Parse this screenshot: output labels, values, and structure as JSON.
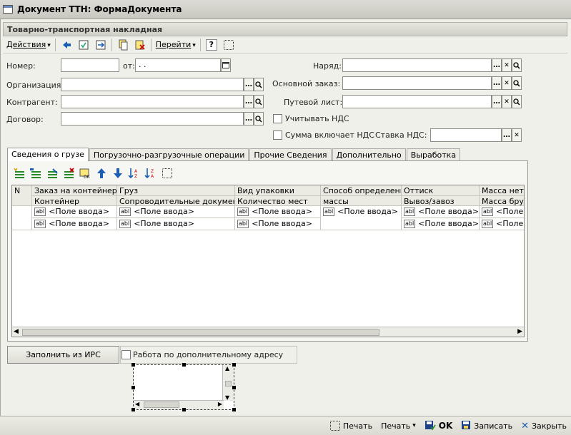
{
  "window": {
    "title": "Документ ТТН: ФормаДокумента"
  },
  "form": {
    "header": "Товарно-транспортная накладная"
  },
  "toolbar": {
    "actions_label": "Действия",
    "goto_label": "Перейти",
    "help_label": "?"
  },
  "fields": {
    "number_label": "Номер:",
    "from_label": "от:",
    "date_value": " .  .",
    "organization_label": "Организация:",
    "counterparty_label": "Контрагент:",
    "contract_label": "Договор:",
    "work_order_label": "Наряд:",
    "main_order_label": "Основной заказ:",
    "waybill_label": "Путевой лист:",
    "vat_label": "Учитывать НДС",
    "sum_incl_vat_label": "Сумма включает НДС",
    "vat_rate_label": "Ставка НДС:"
  },
  "tabs": [
    "Сведения о грузе",
    "Погрузочно-разгрузочные операции",
    "Прочие Сведения",
    "Дополнительно",
    "Выработка"
  ],
  "grid": {
    "headers": {
      "n": "N",
      "container_order": "Заказ на контейнер",
      "container": "Контейнер",
      "cargo": "Груз",
      "accompanying_docs": "Сопроводительные документы",
      "packaging": "Вид упаковки",
      "places": "Количество мест",
      "mass_method": "Способ определения",
      "mass_method2": "массы",
      "imprint": "Оттиск",
      "export_import": "Вывоз/завоз",
      "net_mass": "Масса нетт",
      "gross_mass": "Масса брут"
    },
    "cell_text": "<Поле ввода>",
    "abl": "abl"
  },
  "buttons": {
    "fill_from_irs": "Заполнить из ИРС",
    "extra_address": "Работа по дополнительному адресу"
  },
  "bottom": {
    "print1": "Печать",
    "print2": "Печать",
    "ok": "OK",
    "save": "Записать",
    "close": "Закрыть"
  }
}
